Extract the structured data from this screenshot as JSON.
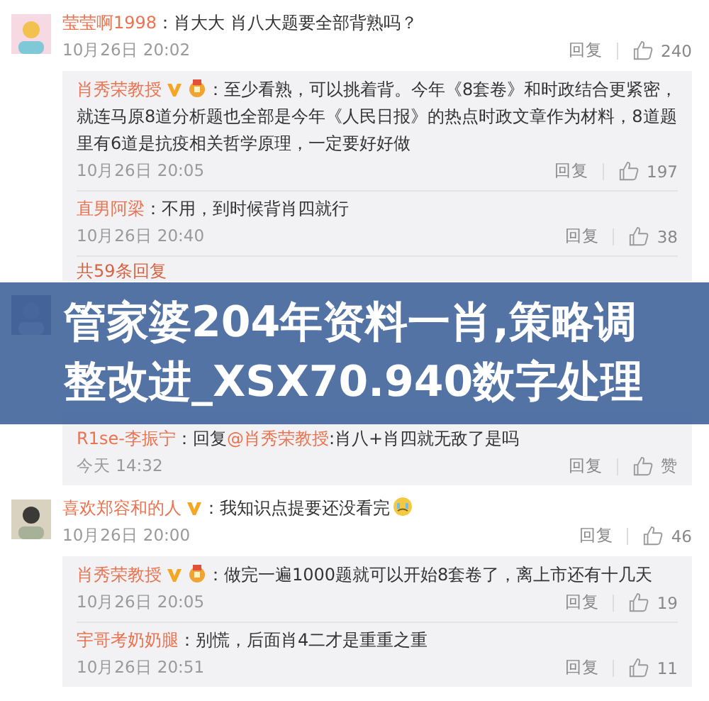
{
  "comments": [
    {
      "user": "莹莹啊1998",
      "verified": false,
      "medal": false,
      "emoji": false,
      "text": "：肖大大 肖八大题要全部背熟吗？",
      "time": "10月26日 20:02",
      "reply": "回复",
      "likes": "240",
      "replies": [
        {
          "user": "肖秀荣教授",
          "verified": true,
          "medal": true,
          "text": "：至少看熟，可以挑着背。今年《8套卷》和时政结合更紧密，就连马原8道分析题也全部是今年《人民日报》的热点时政文章作为材料，8道题里有6道是抗疫相关哲学原理，一定要好好做",
          "time": "10月26日 20:05",
          "reply": "回复",
          "likes": "197"
        },
        {
          "user": "直男阿梁",
          "verified": false,
          "medal": false,
          "text": "：不用，到时候背肖四就行",
          "time": "10月26日 20:40",
          "reply": "回复",
          "likes": "38"
        }
      ],
      "more": "共59条回复"
    },
    {
      "replies": [
        {
          "user": "R1se-李振宁",
          "verified": false,
          "medal": false,
          "prefix": "：回复",
          "mention": "@肖秀荣教授",
          "text": ":肖八+肖四就无敌了是吗",
          "time": "今天 14:32",
          "reply": "回复",
          "likes": "赞"
        }
      ]
    },
    {
      "user": "喜欢郑容和的人",
      "verified": true,
      "medal": false,
      "emoji": true,
      "text": "：我知识点提要还没看完",
      "time": "10月26日 20:00",
      "reply": "回复",
      "likes": "46",
      "replies": [
        {
          "user": "肖秀荣教授",
          "verified": true,
          "medal": true,
          "text": "：做完一遍1000题就可以开始8套卷了，离上市还有十几天",
          "time": "10月26日 20:05",
          "reply": "回复",
          "likes": "19"
        },
        {
          "user": "宇哥考奶奶腿",
          "verified": false,
          "medal": false,
          "text": "：别慌，后面肖4二才是重重之重",
          "time": "10月26日 20:51",
          "reply": "回复",
          "likes": "11"
        }
      ]
    }
  ],
  "banner": {
    "title": "管家婆204年资料一肖,策略调整改进_XSX70.940数字处理"
  }
}
